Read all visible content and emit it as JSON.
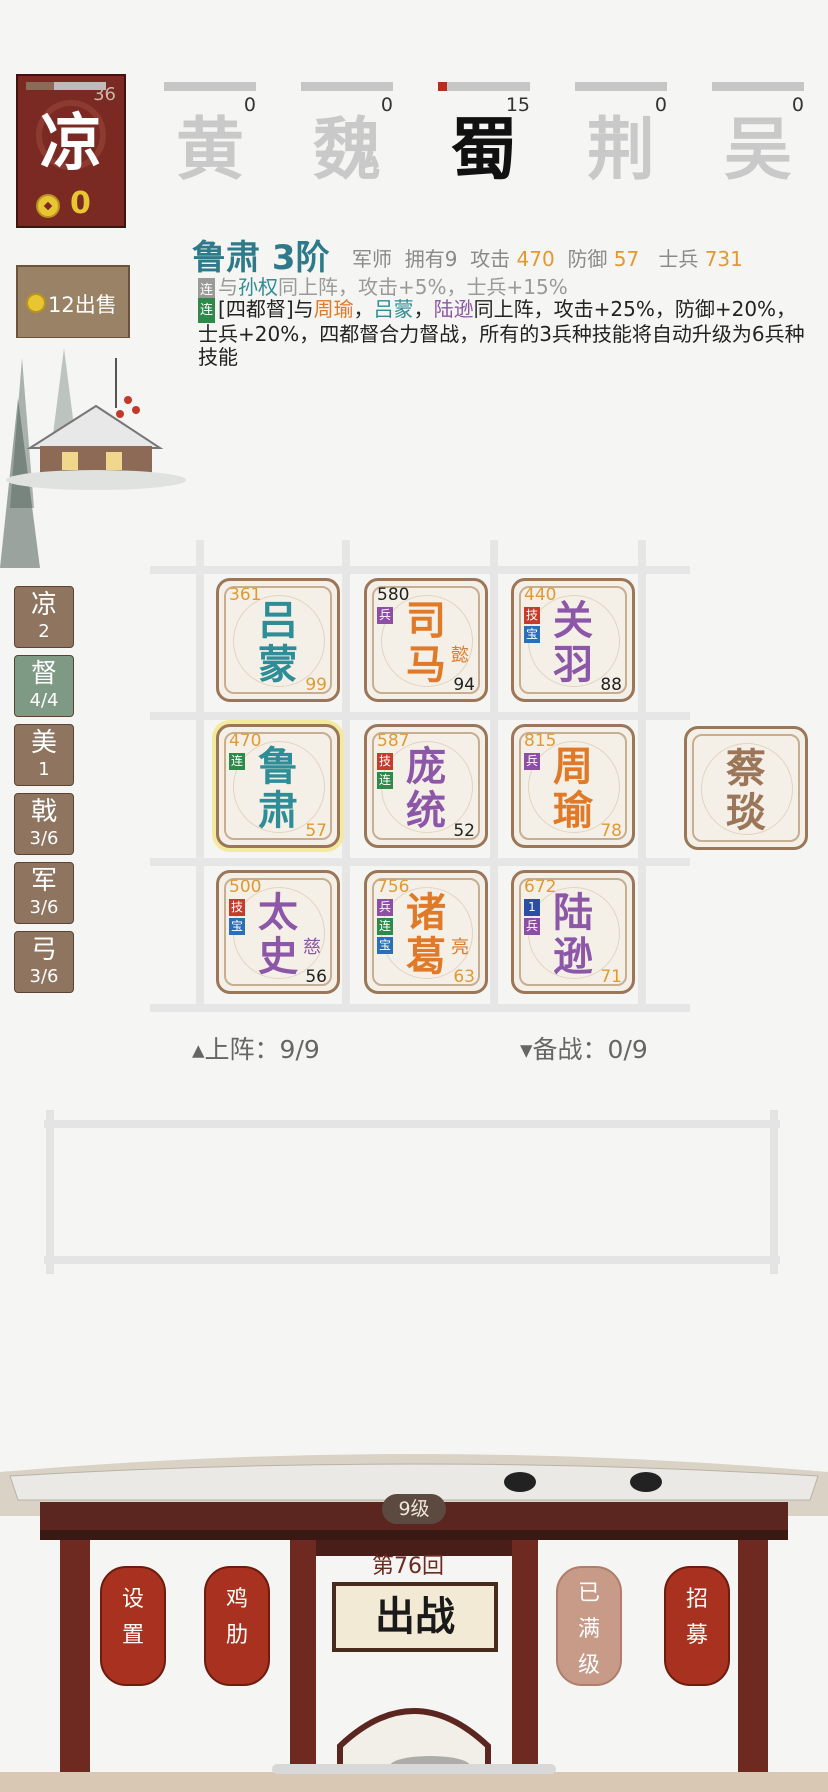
{
  "faction_card": {
    "name": "凉",
    "count": "36",
    "coins": "0",
    "bar_fill": 0.35
  },
  "faction_tabs": [
    {
      "name": "黄",
      "count": "0",
      "fill": 0.0
    },
    {
      "name": "魏",
      "count": "0",
      "fill": 0.0
    },
    {
      "name": "蜀",
      "count": "15",
      "fill": 0.1,
      "active": true
    },
    {
      "name": "荆",
      "count": "0",
      "fill": 0.0
    },
    {
      "name": "吴",
      "count": "0",
      "fill": 0.0
    }
  ],
  "sell_button": {
    "label": "12出售"
  },
  "hero_detail": {
    "title": "鲁肃 3阶",
    "role": "军师",
    "owned": "拥有9",
    "atk_label": "攻击",
    "atk": "470",
    "def_label": "防御",
    "def": "57",
    "troops_label": "士兵",
    "troops": "731",
    "bond1_badge": "连",
    "bond1_pre": "与",
    "bond1_name": "孙权",
    "bond1_post": "同上阵，攻击+5%，士兵+15%",
    "bond2_badge": "连",
    "bond2_a": "[四都督]与",
    "bond2_n1": "周瑜",
    "bond2_sep1": "，",
    "bond2_n2": "吕蒙",
    "bond2_sep2": "，",
    "bond2_n3": "陆逊",
    "bond2_b": "同上阵，攻击+25%，防御+20%，士兵+20%，四都督合力督战，所有的3兵种技能将自动升级为6兵种技能"
  },
  "categories": [
    {
      "name": "凉",
      "count": "2"
    },
    {
      "name": "督",
      "count": "4/4",
      "selected": true
    },
    {
      "name": "美",
      "count": "1"
    },
    {
      "name": "戟",
      "count": "3/6"
    },
    {
      "name": "军",
      "count": "3/6"
    },
    {
      "name": "弓",
      "count": "3/6"
    }
  ],
  "heroes": [
    {
      "name": "吕蒙",
      "power": "361",
      "level": "99",
      "side": "",
      "tags": [],
      "color": "#2e8d96",
      "powcolor": "#e19a32",
      "lvlcolor": "#e19a32"
    },
    {
      "name": "司马",
      "power": "580",
      "level": "94",
      "side": "懿",
      "tags": [
        [
          "兵",
          "t-purple"
        ]
      ],
      "color": "#e07a28",
      "powcolor": "#222",
      "lvlcolor": "#222"
    },
    {
      "name": "关羽",
      "power": "440",
      "level": "88",
      "side": "",
      "tags": [
        [
          "技",
          "t-red"
        ],
        [
          "宝",
          "t-blue"
        ]
      ],
      "color": "#8d57a8",
      "powcolor": "#e19a32",
      "lvlcolor": "#222"
    },
    {
      "name": "鲁肃",
      "power": "470",
      "level": "57",
      "side": "",
      "tags": [
        [
          "连",
          "t-green"
        ]
      ],
      "color": "#2e8d96",
      "powcolor": "#e19a32",
      "lvlcolor": "#e19a32",
      "selected": true
    },
    {
      "name": "庞统",
      "power": "587",
      "level": "52",
      "side": "",
      "tags": [
        [
          "技",
          "t-red"
        ],
        [
          "连",
          "t-green"
        ]
      ],
      "color": "#8d57a8",
      "powcolor": "#e19a32",
      "lvlcolor": "#222"
    },
    {
      "name": "周瑜",
      "power": "815",
      "level": "78",
      "side": "",
      "tags": [
        [
          "兵",
          "t-purple"
        ]
      ],
      "color": "#e07a28",
      "powcolor": "#e19a32",
      "lvlcolor": "#e19a32"
    },
    {
      "name": "太史",
      "power": "500",
      "level": "56",
      "side": "慈",
      "tags": [
        [
          "技",
          "t-red"
        ],
        [
          "宝",
          "t-blue"
        ]
      ],
      "color": "#8d57a8",
      "powcolor": "#e19a32",
      "lvlcolor": "#222"
    },
    {
      "name": "诸葛",
      "power": "756",
      "level": "63",
      "side": "亮",
      "tags": [
        [
          "兵",
          "t-purple"
        ],
        [
          "连",
          "t-green"
        ],
        [
          "宝",
          "t-blue"
        ]
      ],
      "color": "#e07a28",
      "powcolor": "#e19a32",
      "lvlcolor": "#e19a32"
    },
    {
      "name": "陆逊",
      "power": "672",
      "level": "71",
      "side": "",
      "tags": [
        [
          "1",
          "t-navy"
        ],
        [
          "兵",
          "t-purple"
        ]
      ],
      "color": "#8d57a8",
      "powcolor": "#e19a32",
      "lvlcolor": "#e19a32"
    }
  ],
  "extra_hero": {
    "name": "蔡琰"
  },
  "counts": {
    "on_field": "▴上阵：9/9",
    "bench": "▾备战：0/9"
  },
  "bottom": {
    "level": "9级",
    "wave": "第76回",
    "battle": "出战",
    "btn_settings": "设置",
    "btn_rib": "鸡肋",
    "btn_maxed": "已满级",
    "btn_recruit": "招募"
  }
}
